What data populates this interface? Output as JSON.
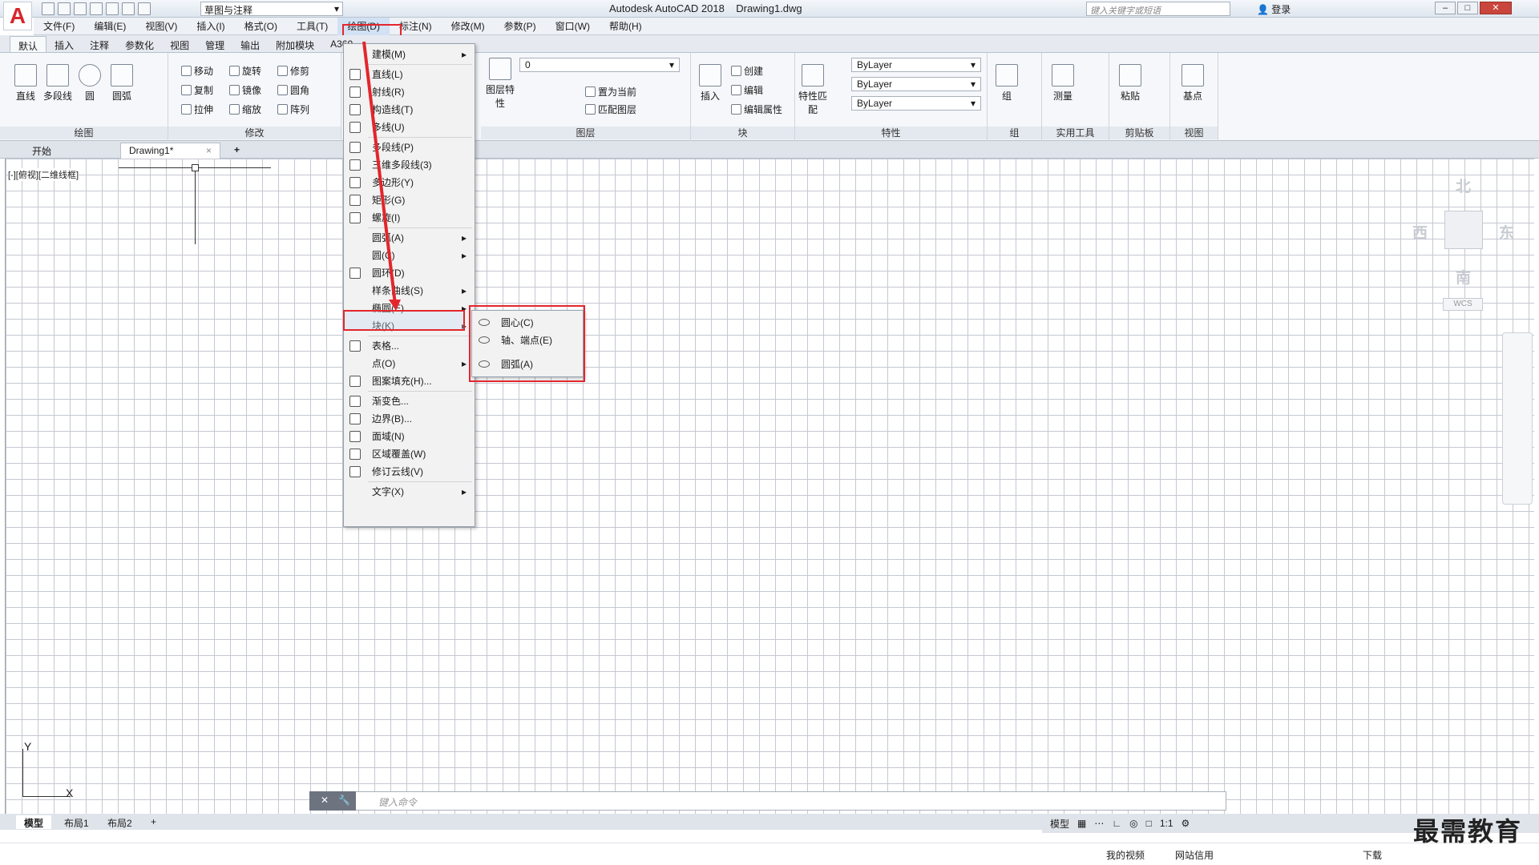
{
  "window": {
    "app_title": "Autodesk AutoCAD 2018",
    "file_name": "Drawing1.dwg",
    "workspace": "草图与注释",
    "search_placeholder": "键入关键字或短语",
    "login": "登录",
    "logo_letter": "A"
  },
  "menubar": {
    "items": [
      "文件(F)",
      "编辑(E)",
      "视图(V)",
      "插入(I)",
      "格式(O)",
      "工具(T)",
      "绘图(D)",
      "标注(N)",
      "修改(M)",
      "参数(P)",
      "窗口(W)",
      "帮助(H)"
    ],
    "active_index": 6
  },
  "ribbon_tabs": [
    "默认",
    "插入",
    "注释",
    "参数化",
    "视图",
    "管理",
    "输出",
    "附加模块",
    "A360"
  ],
  "ribbon": {
    "draw": {
      "title": "绘图",
      "tools": [
        "直线",
        "多段线",
        "圆",
        "圆弧"
      ]
    },
    "modify": {
      "title": "修改",
      "tools": [
        "移动",
        "旋转",
        "修剪",
        "复制",
        "镜像",
        "圆角",
        "拉伸",
        "缩放",
        "阵列"
      ]
    },
    "layers": {
      "title": "图层",
      "big": "图层特性",
      "layer_value": "0",
      "tools": [
        "置为当前",
        "匹配图层"
      ]
    },
    "block": {
      "title": "块",
      "big": "插入",
      "tools": [
        "创建",
        "编辑",
        "编辑属性"
      ]
    },
    "properties": {
      "title": "特性",
      "big": "特性匹配",
      "color": "ByLayer",
      "linetype": "ByLayer",
      "lineweight": "ByLayer"
    },
    "groups": {
      "title": "组",
      "big": "组"
    },
    "utilities": {
      "title": "实用工具",
      "big": "测量"
    },
    "clipboard": {
      "title": "剪贴板",
      "big": "粘贴"
    },
    "view": {
      "title": "视图",
      "big": "基点"
    }
  },
  "doc_tabs": {
    "start": "开始",
    "drawing": "Drawing1*"
  },
  "viewport_label": "[-][俯视][二维线框]",
  "viewcube": {
    "north": "北",
    "south": "南",
    "east": "东",
    "west": "西",
    "wcs": "WCS"
  },
  "ucs": {
    "x": "X",
    "y": "Y"
  },
  "command_placeholder": "键入命令",
  "layout_tabs": [
    "模型",
    "布局1",
    "布局2"
  ],
  "status": {
    "model": "模型",
    "scale": "1:1"
  },
  "draw_menu": {
    "items": [
      {
        "label": "建模(M)",
        "submenu": true
      },
      {
        "label": "直线(L)"
      },
      {
        "label": "射线(R)"
      },
      {
        "label": "构造线(T)"
      },
      {
        "label": "多线(U)"
      },
      {
        "label": "多段线(P)"
      },
      {
        "label": "三维多段线(3)"
      },
      {
        "label": "多边形(Y)"
      },
      {
        "label": "矩形(G)"
      },
      {
        "label": "螺旋(I)"
      },
      {
        "label": "圆弧(A)",
        "submenu": true
      },
      {
        "label": "圆(C)",
        "submenu": true
      },
      {
        "label": "圆环(D)"
      },
      {
        "label": "样条曲线(S)",
        "submenu": true
      },
      {
        "label": "椭圆(E)",
        "submenu": true
      },
      {
        "label": "块(K)",
        "submenu": true
      },
      {
        "label": "表格..."
      },
      {
        "label": "点(O)",
        "submenu": true
      },
      {
        "label": "图案填充(H)..."
      },
      {
        "label": "渐变色..."
      },
      {
        "label": "边界(B)..."
      },
      {
        "label": "面域(N)"
      },
      {
        "label": "区域覆盖(W)"
      },
      {
        "label": "修订云线(V)"
      },
      {
        "label": "文字(X)",
        "submenu": true
      }
    ],
    "highlighted": "椭圆(E)"
  },
  "ellipse_submenu": [
    "圆心(C)",
    "轴、端点(E)",
    "圆弧(A)"
  ],
  "taskbar": {
    "video": "我的视频",
    "trust": "网站信用",
    "download": "下载"
  },
  "watermark": "最需教育",
  "colors": {
    "highlight_red": "#e3262d",
    "logo_red": "#d6262d",
    "grid": "#c4c8d2"
  }
}
